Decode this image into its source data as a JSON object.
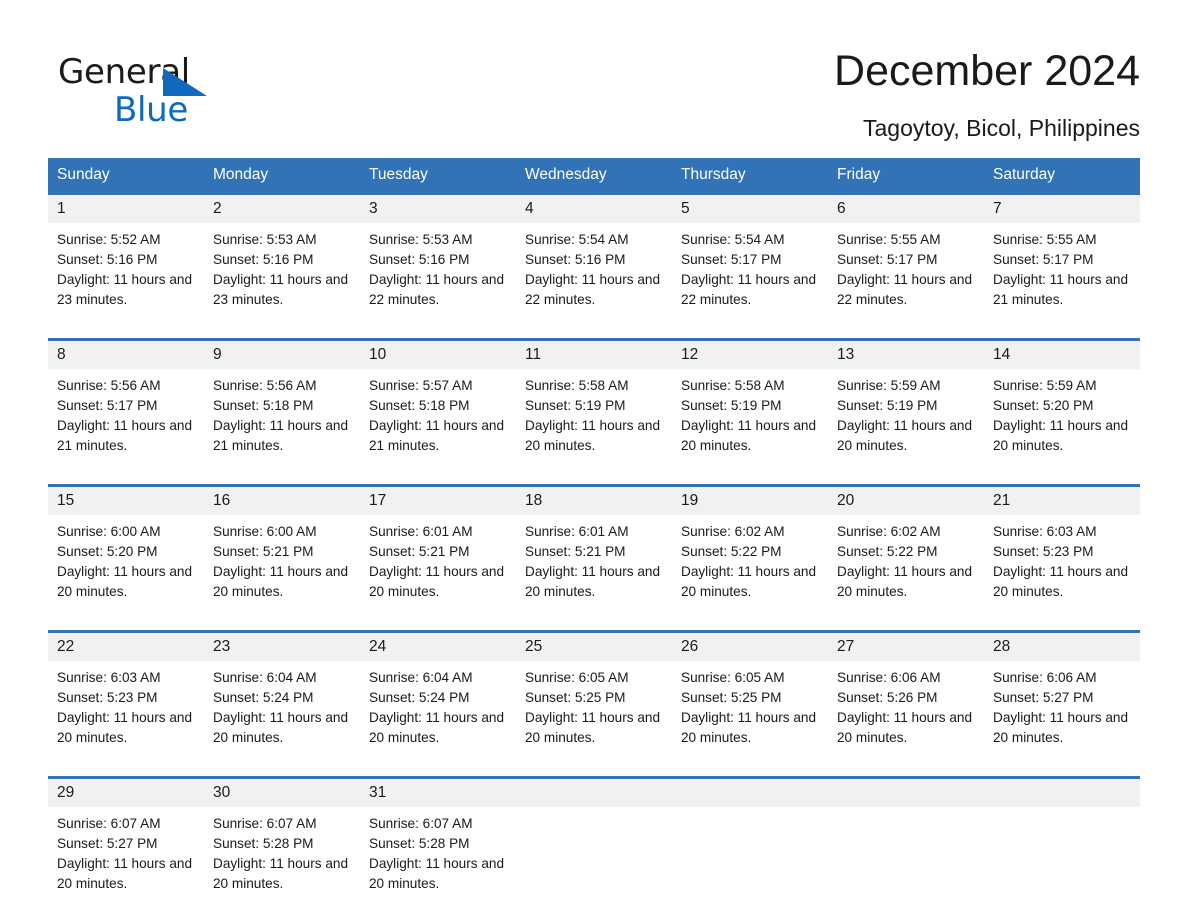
{
  "brand": {
    "name_part1": "General",
    "name_part2": "Blue",
    "accent_color": "#1169bf",
    "triangle_icon": "triangle-icon"
  },
  "header": {
    "month_title": "December 2024",
    "location": "Tagoytoy, Bicol, Philippines"
  },
  "theme": {
    "header_blue": "#3272b6",
    "row_band_gray": "#f1f1f1",
    "text_color": "#1a1a1a"
  },
  "calendar": {
    "weekday_headers": [
      "Sunday",
      "Monday",
      "Tuesday",
      "Wednesday",
      "Thursday",
      "Friday",
      "Saturday"
    ],
    "weeks": [
      {
        "days": [
          {
            "number": "1",
            "sunrise": "Sunrise: 5:52 AM",
            "sunset": "Sunset: 5:16 PM",
            "daylight": "Daylight: 11 hours and 23 minutes."
          },
          {
            "number": "2",
            "sunrise": "Sunrise: 5:53 AM",
            "sunset": "Sunset: 5:16 PM",
            "daylight": "Daylight: 11 hours and 23 minutes."
          },
          {
            "number": "3",
            "sunrise": "Sunrise: 5:53 AM",
            "sunset": "Sunset: 5:16 PM",
            "daylight": "Daylight: 11 hours and 22 minutes."
          },
          {
            "number": "4",
            "sunrise": "Sunrise: 5:54 AM",
            "sunset": "Sunset: 5:16 PM",
            "daylight": "Daylight: 11 hours and 22 minutes."
          },
          {
            "number": "5",
            "sunrise": "Sunrise: 5:54 AM",
            "sunset": "Sunset: 5:17 PM",
            "daylight": "Daylight: 11 hours and 22 minutes."
          },
          {
            "number": "6",
            "sunrise": "Sunrise: 5:55 AM",
            "sunset": "Sunset: 5:17 PM",
            "daylight": "Daylight: 11 hours and 22 minutes."
          },
          {
            "number": "7",
            "sunrise": "Sunrise: 5:55 AM",
            "sunset": "Sunset: 5:17 PM",
            "daylight": "Daylight: 11 hours and 21 minutes."
          }
        ]
      },
      {
        "days": [
          {
            "number": "8",
            "sunrise": "Sunrise: 5:56 AM",
            "sunset": "Sunset: 5:17 PM",
            "daylight": "Daylight: 11 hours and 21 minutes."
          },
          {
            "number": "9",
            "sunrise": "Sunrise: 5:56 AM",
            "sunset": "Sunset: 5:18 PM",
            "daylight": "Daylight: 11 hours and 21 minutes."
          },
          {
            "number": "10",
            "sunrise": "Sunrise: 5:57 AM",
            "sunset": "Sunset: 5:18 PM",
            "daylight": "Daylight: 11 hours and 21 minutes."
          },
          {
            "number": "11",
            "sunrise": "Sunrise: 5:58 AM",
            "sunset": "Sunset: 5:19 PM",
            "daylight": "Daylight: 11 hours and 20 minutes."
          },
          {
            "number": "12",
            "sunrise": "Sunrise: 5:58 AM",
            "sunset": "Sunset: 5:19 PM",
            "daylight": "Daylight: 11 hours and 20 minutes."
          },
          {
            "number": "13",
            "sunrise": "Sunrise: 5:59 AM",
            "sunset": "Sunset: 5:19 PM",
            "daylight": "Daylight: 11 hours and 20 minutes."
          },
          {
            "number": "14",
            "sunrise": "Sunrise: 5:59 AM",
            "sunset": "Sunset: 5:20 PM",
            "daylight": "Daylight: 11 hours and 20 minutes."
          }
        ]
      },
      {
        "days": [
          {
            "number": "15",
            "sunrise": "Sunrise: 6:00 AM",
            "sunset": "Sunset: 5:20 PM",
            "daylight": "Daylight: 11 hours and 20 minutes."
          },
          {
            "number": "16",
            "sunrise": "Sunrise: 6:00 AM",
            "sunset": "Sunset: 5:21 PM",
            "daylight": "Daylight: 11 hours and 20 minutes."
          },
          {
            "number": "17",
            "sunrise": "Sunrise: 6:01 AM",
            "sunset": "Sunset: 5:21 PM",
            "daylight": "Daylight: 11 hours and 20 minutes."
          },
          {
            "number": "18",
            "sunrise": "Sunrise: 6:01 AM",
            "sunset": "Sunset: 5:21 PM",
            "daylight": "Daylight: 11 hours and 20 minutes."
          },
          {
            "number": "19",
            "sunrise": "Sunrise: 6:02 AM",
            "sunset": "Sunset: 5:22 PM",
            "daylight": "Daylight: 11 hours and 20 minutes."
          },
          {
            "number": "20",
            "sunrise": "Sunrise: 6:02 AM",
            "sunset": "Sunset: 5:22 PM",
            "daylight": "Daylight: 11 hours and 20 minutes."
          },
          {
            "number": "21",
            "sunrise": "Sunrise: 6:03 AM",
            "sunset": "Sunset: 5:23 PM",
            "daylight": "Daylight: 11 hours and 20 minutes."
          }
        ]
      },
      {
        "days": [
          {
            "number": "22",
            "sunrise": "Sunrise: 6:03 AM",
            "sunset": "Sunset: 5:23 PM",
            "daylight": "Daylight: 11 hours and 20 minutes."
          },
          {
            "number": "23",
            "sunrise": "Sunrise: 6:04 AM",
            "sunset": "Sunset: 5:24 PM",
            "daylight": "Daylight: 11 hours and 20 minutes."
          },
          {
            "number": "24",
            "sunrise": "Sunrise: 6:04 AM",
            "sunset": "Sunset: 5:24 PM",
            "daylight": "Daylight: 11 hours and 20 minutes."
          },
          {
            "number": "25",
            "sunrise": "Sunrise: 6:05 AM",
            "sunset": "Sunset: 5:25 PM",
            "daylight": "Daylight: 11 hours and 20 minutes."
          },
          {
            "number": "26",
            "sunrise": "Sunrise: 6:05 AM",
            "sunset": "Sunset: 5:25 PM",
            "daylight": "Daylight: 11 hours and 20 minutes."
          },
          {
            "number": "27",
            "sunrise": "Sunrise: 6:06 AM",
            "sunset": "Sunset: 5:26 PM",
            "daylight": "Daylight: 11 hours and 20 minutes."
          },
          {
            "number": "28",
            "sunrise": "Sunrise: 6:06 AM",
            "sunset": "Sunset: 5:27 PM",
            "daylight": "Daylight: 11 hours and 20 minutes."
          }
        ]
      },
      {
        "days": [
          {
            "number": "29",
            "sunrise": "Sunrise: 6:07 AM",
            "sunset": "Sunset: 5:27 PM",
            "daylight": "Daylight: 11 hours and 20 minutes."
          },
          {
            "number": "30",
            "sunrise": "Sunrise: 6:07 AM",
            "sunset": "Sunset: 5:28 PM",
            "daylight": "Daylight: 11 hours and 20 minutes."
          },
          {
            "number": "31",
            "sunrise": "Sunrise: 6:07 AM",
            "sunset": "Sunset: 5:28 PM",
            "daylight": "Daylight: 11 hours and 20 minutes."
          },
          {
            "number": "",
            "sunrise": "",
            "sunset": "",
            "daylight": ""
          },
          {
            "number": "",
            "sunrise": "",
            "sunset": "",
            "daylight": ""
          },
          {
            "number": "",
            "sunrise": "",
            "sunset": "",
            "daylight": ""
          },
          {
            "number": "",
            "sunrise": "",
            "sunset": "",
            "daylight": ""
          }
        ]
      }
    ]
  }
}
